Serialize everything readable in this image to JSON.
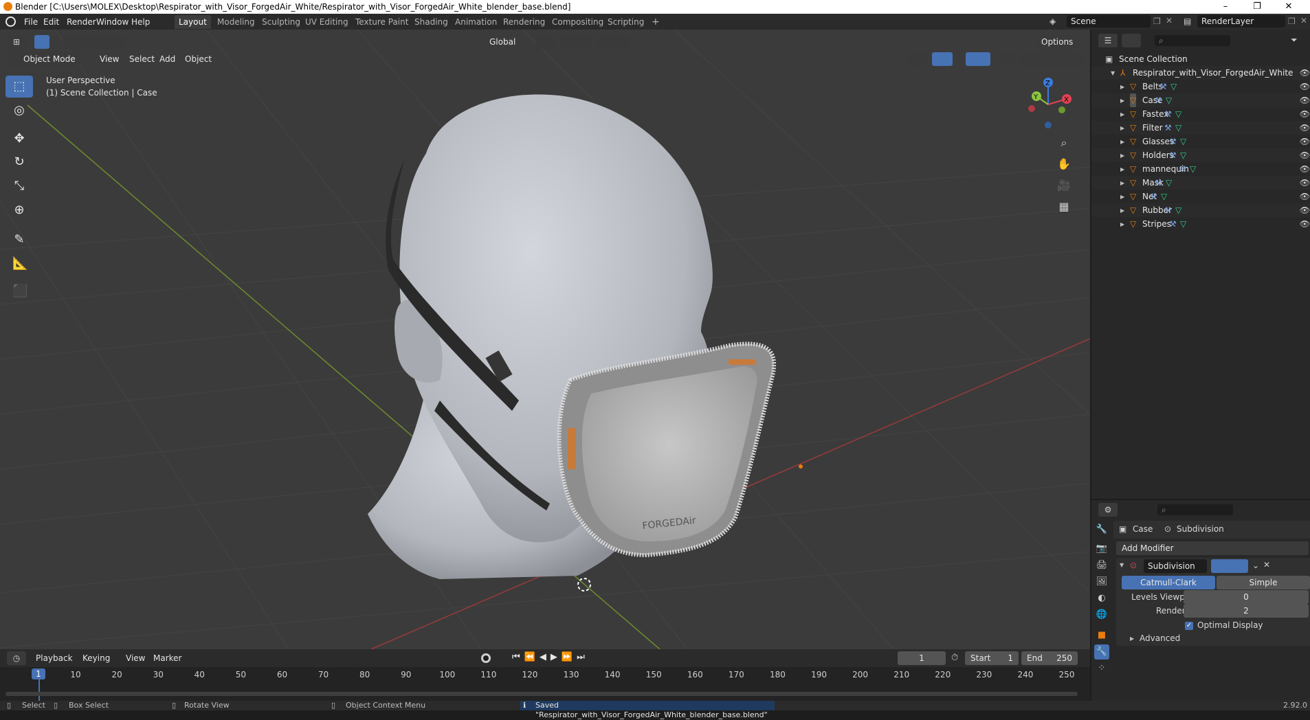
{
  "window": {
    "title": "Blender [C:\\Users\\MOLEX\\Desktop\\Respirator_with_Visor_ForgedAir_White/Respirator_with_Visor_ForgedAir_White_blender_base.blend]",
    "minimize": "–",
    "maximize": "❐",
    "close": "✕"
  },
  "menu": [
    "File",
    "Edit",
    "Render",
    "Window",
    "Help"
  ],
  "workspaces": [
    "Layout",
    "Modeling",
    "Sculpting",
    "UV Editing",
    "Texture Paint",
    "Shading",
    "Animation",
    "Rendering",
    "Compositing",
    "Scripting"
  ],
  "active_workspace": "Layout",
  "scene_name": "Scene",
  "view_layer": "RenderLayer",
  "viewport": {
    "mode": "Object Mode",
    "menus": [
      "View",
      "Select",
      "Add",
      "Object"
    ],
    "transform_orientation": "Global",
    "options_label": "Options",
    "overlay_line1": "User Perspective",
    "overlay_line2": "(1) Scene Collection | Case",
    "gizmo_axes": {
      "x": "X",
      "y": "Y",
      "z": "Z"
    }
  },
  "outliner": {
    "root": "Scene Collection",
    "collection": "Respirator_with_Visor_ForgedAir_White",
    "objects": [
      "Belts",
      "Case",
      "Fastex",
      "Filter",
      "Glasses",
      "Holders",
      "mannequin",
      "Mask",
      "Net",
      "Rubber",
      "Stripes"
    ],
    "active_object": "Case"
  },
  "properties": {
    "object_name": "Case",
    "modifier_context": "Subdivision",
    "add_modifier": "Add Modifier",
    "modifier": {
      "name": "Subdivision",
      "type_options": [
        "Catmull-Clark",
        "Simple"
      ],
      "selected_type": "Catmull-Clark",
      "levels_viewport_label": "Levels Viewport",
      "levels_viewport": "0",
      "render_label": "Render",
      "render": "2",
      "optimal_display_label": "Optimal Display",
      "optimal_display": true,
      "advanced_label": "Advanced"
    }
  },
  "timeline": {
    "menus": [
      "Playback",
      "Keying",
      "View",
      "Marker"
    ],
    "current_frame": "1",
    "start_label": "Start",
    "start": "1",
    "end_label": "End",
    "end": "250",
    "ticks": [
      "10",
      "20",
      "30",
      "40",
      "50",
      "60",
      "70",
      "80",
      "90",
      "100",
      "110",
      "120",
      "130",
      "140",
      "150",
      "160",
      "170",
      "180",
      "190",
      "200",
      "210",
      "220",
      "230",
      "240",
      "250"
    ],
    "playhead": "1"
  },
  "statusbar": {
    "select": "Select",
    "box_select": "Box Select",
    "rotate_view": "Rotate View",
    "context_menu": "Object Context Menu",
    "message": "Saved \"Respirator_with_Visor_ForgedAir_White_blender_base.blend\"",
    "version": "2.92.0"
  },
  "mask_brand": "FORGEDAir",
  "colors": {
    "accent": "#4772b3",
    "object_orange": "#e87d0d",
    "axis_x": "#e04453",
    "axis_y": "#8cc63f",
    "axis_z": "#3b7ddd"
  }
}
